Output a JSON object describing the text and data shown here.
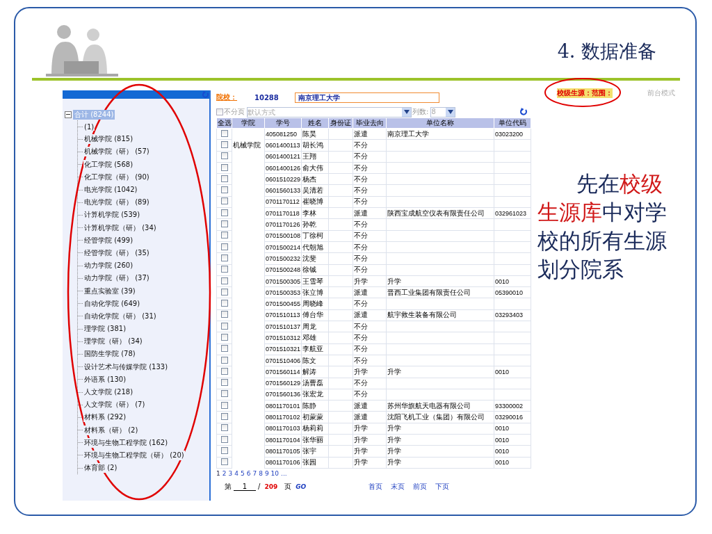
{
  "slide": {
    "title": "4. 数据准备",
    "note": [
      {
        "text": "先在",
        "highlight": false
      },
      {
        "text": "校级",
        "highlight": true
      },
      {
        "text": "生源库",
        "highlight": true
      },
      {
        "text": "中对学校的所有生源划分院系",
        "highlight": false
      }
    ]
  },
  "app": {
    "tree": {
      "label": "合计 (8244)",
      "expanded": true,
      "selected": true,
      "children": [
        {
          "label": "(1)"
        },
        {
          "label": "机械学院 (815)"
        },
        {
          "label": "机械学院（研） (57)"
        },
        {
          "label": "化工学院 (568)"
        },
        {
          "label": "化工学院（研） (90)"
        },
        {
          "label": "电光学院 (1042)"
        },
        {
          "label": "电光学院（研） (89)"
        },
        {
          "label": "计算机学院 (539)"
        },
        {
          "label": "计算机学院（研） (34)"
        },
        {
          "label": "经管学院 (499)"
        },
        {
          "label": "经管学院（研） (35)"
        },
        {
          "label": "动力学院 (260)"
        },
        {
          "label": "动力学院（研） (37)"
        },
        {
          "label": "重点实验室 (39)"
        },
        {
          "label": "自动化学院 (649)"
        },
        {
          "label": "自动化学院（研） (31)"
        },
        {
          "label": "理学院 (381)"
        },
        {
          "label": "理学院（研） (34)"
        },
        {
          "label": "国防生学院 (78)"
        },
        {
          "label": "设计艺术与传媒学院 (133)"
        },
        {
          "label": "外语系 (130)"
        },
        {
          "label": "人文学院 (218)"
        },
        {
          "label": "人文学院（研） (7)"
        },
        {
          "label": "材料系 (292)"
        },
        {
          "label": "材料系（研） (2)"
        },
        {
          "label": "环境与生物工程学院 (162)"
        },
        {
          "label": "环境与生物工程学院（研） (20)"
        },
        {
          "label": "体育部 (2)"
        }
      ]
    },
    "school": {
      "label": "院校：",
      "code": "10288",
      "name": "南京理工大学"
    },
    "source_label": "校级生源：范围：",
    "mode_link": "前台模式",
    "toolbar": {
      "no_paging": {
        "label": "不分页",
        "checked": false,
        "disabled": true
      },
      "sort": {
        "value": "默认方式",
        "disabled": true
      },
      "columns_label": "列数:",
      "columns": {
        "value": "8",
        "disabled": true
      }
    },
    "table": {
      "columns": [
        "全选",
        "学院",
        "学号",
        "姓名",
        "身份证",
        "毕业去向",
        "单位名称",
        "单位代码"
      ],
      "rows": [
        {
          "checked": false,
          "id": "405081250",
          "name": "陈昊",
          "destination": "派遣",
          "employer": "南京理工大学",
          "code": "03023200"
        },
        {
          "checked": false,
          "college": "机械学院",
          "id": "0601400113",
          "name": "胡长鸿",
          "destination": "不分"
        },
        {
          "checked": false,
          "id": "0601400121",
          "name": "王翔",
          "destination": "不分"
        },
        {
          "checked": false,
          "id": "0601400126",
          "name": "俞大伟",
          "destination": "不分"
        },
        {
          "checked": false,
          "id": "0601510229",
          "name": "杨杰",
          "destination": "不分"
        },
        {
          "checked": false,
          "id": "0601560133",
          "name": "吴清若",
          "destination": "不分"
        },
        {
          "checked": false,
          "id": "0701170112",
          "name": "崔晓博",
          "destination": "不分"
        },
        {
          "checked": false,
          "id": "0701170118",
          "name": "李林",
          "destination": "派遣",
          "employer": "陕西宝成航空仪表有限责任公司",
          "code": "032961023"
        },
        {
          "checked": false,
          "id": "0701170126",
          "name": "孙乾",
          "destination": "不分"
        },
        {
          "checked": false,
          "id": "0701500108",
          "name": "丁徐柯",
          "destination": "不分"
        },
        {
          "checked": false,
          "id": "0701500214",
          "name": "代朝旭",
          "destination": "不分"
        },
        {
          "checked": false,
          "id": "0701500232",
          "name": "沈斐",
          "destination": "不分"
        },
        {
          "checked": false,
          "id": "0701500248",
          "name": "徐铖",
          "destination": "不分"
        },
        {
          "checked": false,
          "id": "0701500305",
          "name": "王雪琴",
          "destination": "升学",
          "employer": "升学",
          "code": "0010"
        },
        {
          "checked": false,
          "id": "0701500353",
          "name": "张立博",
          "destination": "派遣",
          "employer": "晋西工业集团有限责任公司",
          "code": "05390010"
        },
        {
          "checked": false,
          "id": "0701500455",
          "name": "周晓峰",
          "destination": "不分"
        },
        {
          "checked": false,
          "id": "0701510113",
          "name": "傅台华",
          "destination": "派遣",
          "employer": "航宇救生装备有限公司",
          "code": "03293403"
        },
        {
          "checked": false,
          "id": "0701510137",
          "name": "周龙",
          "destination": "不分"
        },
        {
          "checked": false,
          "id": "0701510312",
          "name": "邓雄",
          "destination": "不分"
        },
        {
          "checked": false,
          "id": "0701510321",
          "name": "李航亚",
          "destination": "不分"
        },
        {
          "checked": false,
          "id": "0701510406",
          "name": "陈文",
          "destination": "不分"
        },
        {
          "checked": false,
          "id": "0701560114",
          "name": "解涛",
          "destination": "升学",
          "employer": "升学",
          "code": "0010"
        },
        {
          "checked": false,
          "id": "0701560129",
          "name": "汤曹磊",
          "destination": "不分"
        },
        {
          "checked": false,
          "id": "0701560136",
          "name": "张宏龙",
          "destination": "不分"
        },
        {
          "checked": false,
          "id": "0801170101",
          "name": "陈静",
          "destination": "派遣",
          "employer": "苏州华旗航天电器有限公司",
          "code": "93300002"
        },
        {
          "checked": false,
          "id": "0801170102",
          "name": "初蒙蒙",
          "destination": "派遣",
          "employer": "沈阳飞机工业（集团）有限公司",
          "code": "03290016"
        },
        {
          "checked": false,
          "id": "0801170103",
          "name": "杨莉莉",
          "destination": "升学",
          "employer": "升学",
          "code": "0010"
        },
        {
          "checked": false,
          "id": "0801170104",
          "name": "张华丽",
          "destination": "升学",
          "employer": "升学",
          "code": "0010"
        },
        {
          "checked": false,
          "id": "0801170105",
          "name": "张宇",
          "destination": "升学",
          "employer": "升学",
          "code": "0010"
        },
        {
          "checked": false,
          "id": "0801170106",
          "name": "张园",
          "destination": "升学",
          "employer": "升学",
          "code": "0010"
        }
      ]
    },
    "pages": [
      "1",
      "2",
      "3",
      "4",
      "5",
      "6",
      "7",
      "8",
      "9",
      "10",
      "..."
    ],
    "pager": {
      "prefix": "第",
      "page": "1",
      "separator": "/",
      "total": "209",
      "suffix": "页",
      "go": "GO",
      "links": [
        "首页",
        "末页",
        "前页",
        "下页"
      ]
    }
  }
}
